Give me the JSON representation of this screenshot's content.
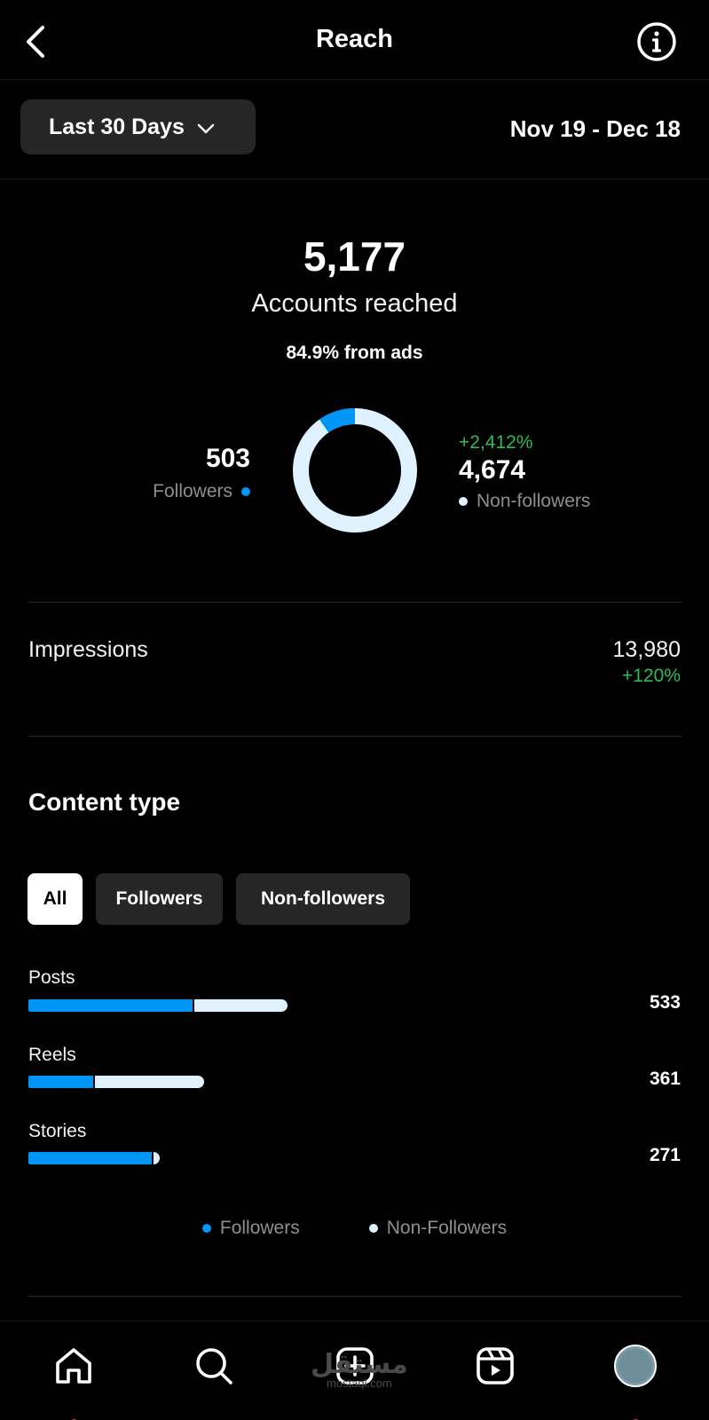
{
  "header": {
    "title": "Reach",
    "back_icon": "chevron-left-icon",
    "info_icon": "info-icon"
  },
  "datebar": {
    "range_label": "Last 30 Days",
    "date_range": "Nov 19 - Dec 18"
  },
  "summary": {
    "accounts_reached": "5,177",
    "accounts_label": "Accounts reached",
    "ads_label": "84.9% from ads",
    "followers": {
      "value": "503",
      "label": "Followers"
    },
    "non_followers": {
      "change": "+2,412%",
      "value": "4,674",
      "label": "Non-followers"
    },
    "donut": {
      "followers_fraction": 0.0972,
      "non_followers_fraction": 0.9028
    }
  },
  "impressions": {
    "label": "Impressions",
    "value": "13,980",
    "change": "+120%"
  },
  "content_type": {
    "title": "Content type",
    "tabs": [
      {
        "label": "All",
        "active": true
      },
      {
        "label": "Followers",
        "active": false
      },
      {
        "label": "Non-followers",
        "active": false
      }
    ],
    "rows": [
      {
        "label": "Posts",
        "value": "533",
        "total": 533,
        "followers": 340
      },
      {
        "label": "Reels",
        "value": "361",
        "total": 361,
        "followers": 135
      },
      {
        "label": "Stories",
        "value": "271",
        "total": 271,
        "followers": 255
      }
    ],
    "legend": {
      "followers": "Followers",
      "non_followers": "Non-Followers"
    }
  },
  "nav": {
    "items": [
      "home-icon",
      "search-icon",
      "create-icon",
      "reels-icon",
      "profile-avatar"
    ]
  },
  "watermark": {
    "arabic": "مستقل",
    "latin": "mostaql.com"
  },
  "colors": {
    "followers": "#0095f6",
    "non_followers": "#e0f1ff",
    "positive": "#2cbb55"
  }
}
